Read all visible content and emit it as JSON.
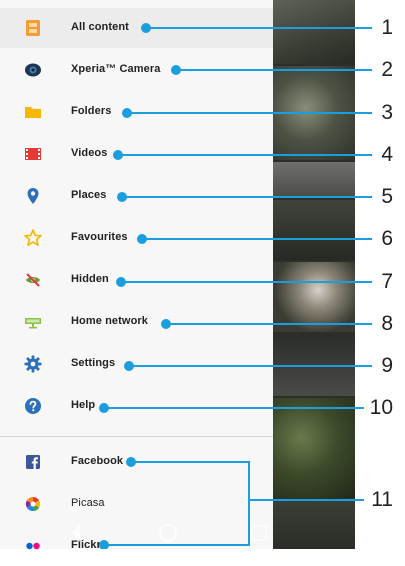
{
  "menu": {
    "items": [
      {
        "label": "All content",
        "icon": "all-content-icon"
      },
      {
        "label": "Xperia™ Camera",
        "icon": "camera-icon"
      },
      {
        "label": "Folders",
        "icon": "folder-icon"
      },
      {
        "label": "Videos",
        "icon": "video-icon"
      },
      {
        "label": "Places",
        "icon": "location-pin-icon"
      },
      {
        "label": "Favourites",
        "icon": "star-icon"
      },
      {
        "label": "Hidden",
        "icon": "hidden-icon"
      },
      {
        "label": "Home network",
        "icon": "home-network-icon"
      },
      {
        "label": "Settings",
        "icon": "gear-icon"
      },
      {
        "label": "Help",
        "icon": "help-icon"
      }
    ],
    "services": [
      {
        "label": "Facebook",
        "icon": "facebook-icon"
      },
      {
        "label": "Picasa",
        "icon": "picasa-icon"
      },
      {
        "label": "Flickr",
        "icon": "flickr-icon"
      }
    ]
  },
  "callouts": [
    "1",
    "2",
    "3",
    "4",
    "5",
    "6",
    "7",
    "8",
    "9",
    "10",
    "11"
  ],
  "colors": {
    "accent": "#1a9ee0",
    "folder": "#f5b700",
    "video": "#e53935",
    "settings": "#2d6fb8"
  }
}
